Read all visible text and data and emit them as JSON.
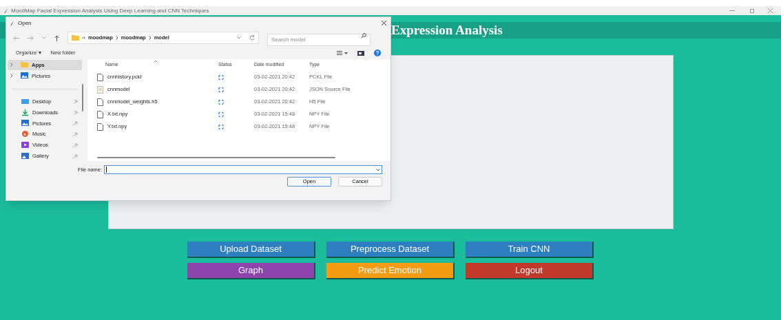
{
  "window": {
    "title": "MoodMap Facial Expression Analysis Using Deep Learning and CNN Techniques"
  },
  "heading": "Expression Analysis",
  "buttons": [
    {
      "label": "Upload Dataset",
      "color": "#2e7fc0"
    },
    {
      "label": "Preprocess Dataset",
      "color": "#2e7fc0"
    },
    {
      "label": "Train CNN",
      "color": "#2e7fc0"
    },
    {
      "label": "Graph",
      "color": "#8e44ad"
    },
    {
      "label": "Predict Emotion",
      "color": "#f39c12"
    },
    {
      "label": "Logout",
      "color": "#c0392b"
    }
  ],
  "dialog": {
    "title": "Open",
    "breadcrumb": [
      "moodmap",
      "moodmap",
      "model"
    ],
    "search": {
      "placeholder": "Search model"
    },
    "toolbar": [
      "Organize ▾",
      "New folder"
    ],
    "sidebar": [
      {
        "label": "Apps",
        "kind": "folder",
        "selected": true,
        "pinned": false,
        "expandable": true
      },
      {
        "label": "Pictures",
        "kind": "pictures",
        "selected": false,
        "pinned": false,
        "expandable": true
      },
      {
        "label": "Desktop",
        "kind": "desktop",
        "selected": false,
        "pinned": true,
        "expandable": false
      },
      {
        "label": "Downloads",
        "kind": "downloads",
        "selected": false,
        "pinned": true,
        "expandable": false
      },
      {
        "label": "Pictures",
        "kind": "pictures",
        "selected": false,
        "pinned": true,
        "expandable": false
      },
      {
        "label": "Music",
        "kind": "music",
        "selected": false,
        "pinned": true,
        "expandable": false
      },
      {
        "label": "Videos",
        "kind": "videos",
        "selected": false,
        "pinned": true,
        "expandable": false
      },
      {
        "label": "Gallery",
        "kind": "gallery",
        "selected": false,
        "pinned": true,
        "expandable": false
      }
    ],
    "columns": [
      "Name",
      "Status",
      "Date modified",
      "Type"
    ],
    "files": [
      {
        "name": "cnnhistory.pckl",
        "date": "03-02-2021 20:42",
        "type": "PCKL File",
        "kind": "file"
      },
      {
        "name": "cnnmodel",
        "date": "03-02-2021 20:42",
        "type": "JSON Source File",
        "kind": "json"
      },
      {
        "name": "cnnmodel_weights.h5",
        "date": "03-02-2021 20:42",
        "type": "H5 File",
        "kind": "file"
      },
      {
        "name": "X.txt.npy",
        "date": "03-02-2021 15:48",
        "type": "NPY File",
        "kind": "file"
      },
      {
        "name": "Y.txt.npy",
        "date": "03-02-2021 15:48",
        "type": "NPY File",
        "kind": "file"
      }
    ],
    "file_name_label": "File name:",
    "open_button": "Open",
    "cancel_button": "Cancel"
  }
}
